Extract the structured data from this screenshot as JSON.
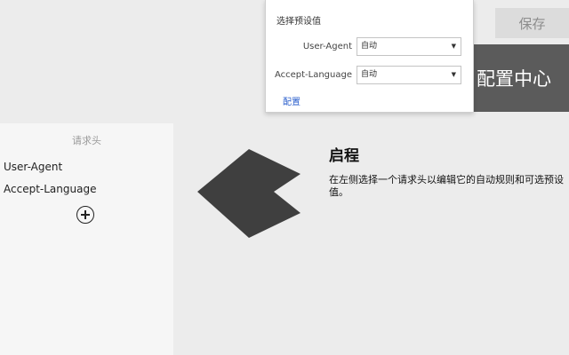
{
  "toolbar": {
    "save_label": "保存",
    "config_center_label": "配置中心"
  },
  "popup": {
    "title": "选择预设值",
    "rows": [
      {
        "label": "User-Agent",
        "value": "自动"
      },
      {
        "label": "Accept-Language",
        "value": "自动"
      }
    ],
    "caret_icon": "dropdown-caret-icon",
    "link_label": "配置"
  },
  "sidebar": {
    "title": "请求头",
    "items": [
      {
        "label": "User-Agent"
      },
      {
        "label": "Accept-Language"
      }
    ],
    "add_icon": "add-circle-icon"
  },
  "main": {
    "arrow_icon": "left-arrow-icon",
    "title": "启程",
    "description": "在左侧选择一个请求头以编辑它的自动规则和可选预设值。"
  },
  "colors": {
    "background": "#ececec",
    "panel": "#f6f6f6",
    "banner": "#5b5b5b",
    "arrow": "#3f3f3f",
    "link": "#2b5fcc"
  }
}
